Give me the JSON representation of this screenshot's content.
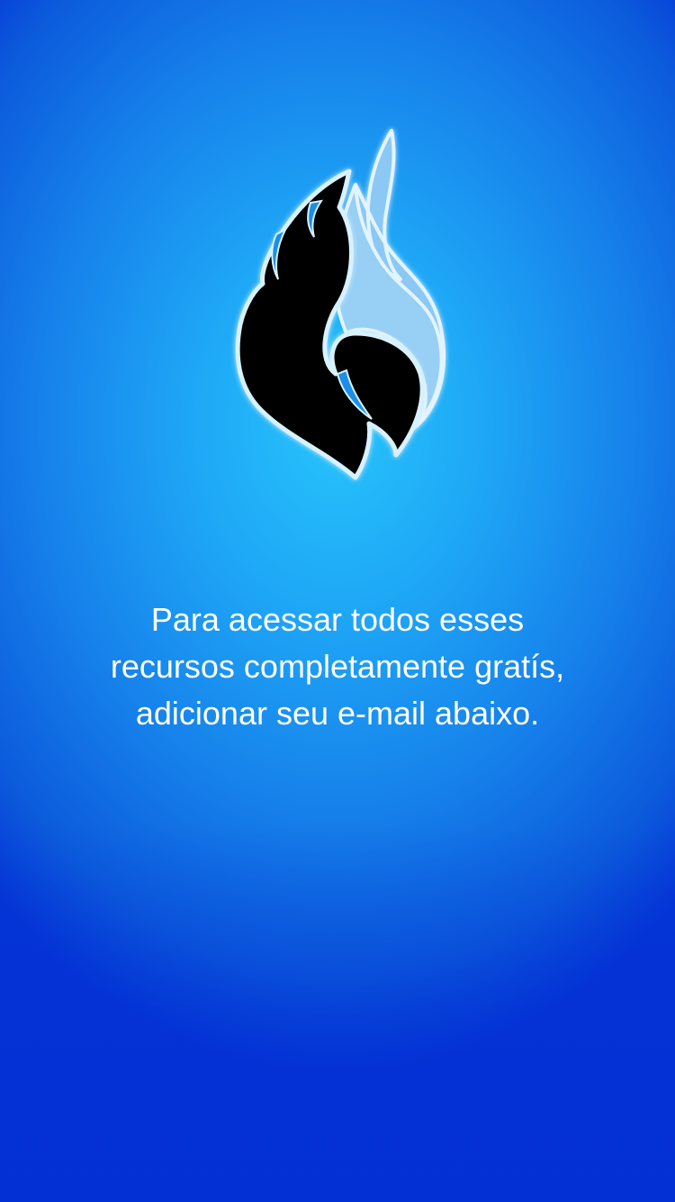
{
  "onboarding": {
    "logo": {
      "icon": "flame-icon",
      "dark_color": "#000000",
      "light_color": "#8cc8f4",
      "outline_color": "#d8f1ff"
    },
    "message_lines": [
      "Para acessar todos esses",
      "recursos completamente gratís,",
      "adicionar seu e-mail abaixo."
    ]
  },
  "theme": {
    "background_center": "#27c4fb",
    "background_edge": "#0434d6",
    "text_color": "#ffffff"
  }
}
